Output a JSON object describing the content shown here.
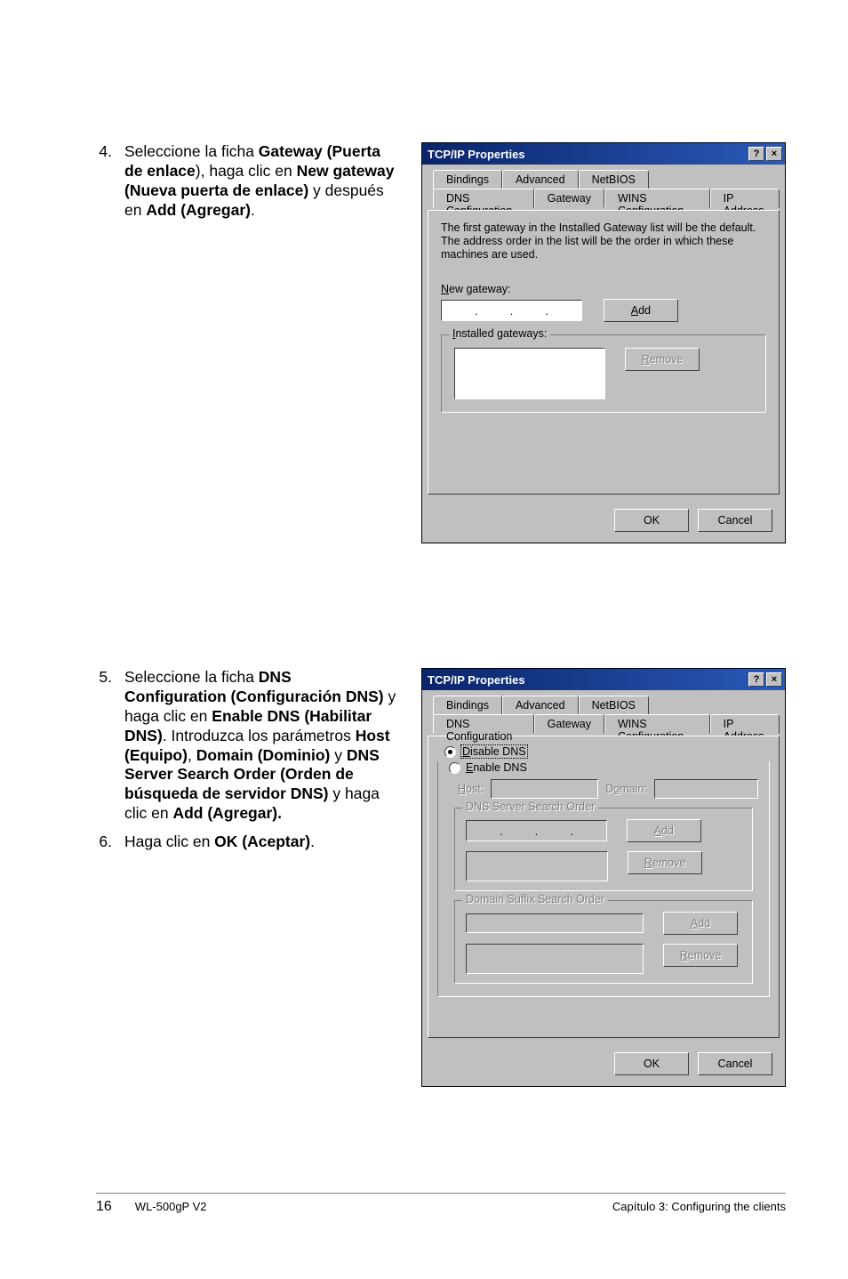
{
  "steps": {
    "s4": {
      "num": "4.",
      "pre1": "Seleccione la ficha ",
      "b1": "Gateway (Puerta de enlace",
      "mid1": "), haga clic en ",
      "b2": "New gateway (Nueva puerta de enlace)",
      "mid2": " y después en ",
      "b3": "Add (Agregar)",
      "post": "."
    },
    "s5": {
      "num": "5.",
      "pre1": "Seleccione la ficha ",
      "b1": "DNS Configuration (Configuración DNS)",
      "mid1": " y haga clic en ",
      "b2": "Enable DNS (Habilitar DNS)",
      "mid2": ". Introduzca los parámetros ",
      "b3": "Host (Equipo)",
      "mid3": ", ",
      "b4": "Domain (Dominio)",
      "mid4": " y ",
      "b5": "DNS Server Search Order (Orden de búsqueda de servidor DNS)",
      "mid5": " y haga clic en ",
      "b6": "Add (Agregar).",
      "post": ""
    },
    "s6": {
      "num": "6.",
      "pre1": "Haga clic en ",
      "b1": "OK (Aceptar)",
      "post": "."
    }
  },
  "dialog": {
    "title": "TCP/IP Properties",
    "help": "?",
    "close": "×",
    "tabs_back": [
      "Bindings",
      "Advanced",
      "NetBIOS"
    ],
    "tabs_front": [
      "DNS Configuration",
      "Gateway",
      "WINS Configuration",
      "IP Address"
    ],
    "ok": "OK",
    "cancel": "Cancel"
  },
  "gateway": {
    "info": "The first gateway in the Installed Gateway list will be the default. The address order in the list will be the order in which these machines are used.",
    "new_label_pre": "N",
    "new_label": "ew gateway:",
    "add_pre": "A",
    "add": "dd",
    "group_pre": "I",
    "group": "nstalled gateways:",
    "remove_pre": "R",
    "remove": "emove"
  },
  "dns": {
    "disable_pre": "D",
    "disable": "isable DNS",
    "enable_pre": "E",
    "enable": "nable DNS",
    "host_pre": "H",
    "host": "ost:",
    "domain_pre": "o",
    "domain_before": "D",
    "domain_after": "main:",
    "group1": "DNS Server Search Order",
    "group2": "Domain Suffix Search Order",
    "add_pre": "A",
    "add": "dd",
    "remove_pre": "R",
    "remove": "emove"
  },
  "footer": {
    "page": "16",
    "model": "WL-500gP V2",
    "chapter": "Capítulo 3: Configuring the clients"
  }
}
